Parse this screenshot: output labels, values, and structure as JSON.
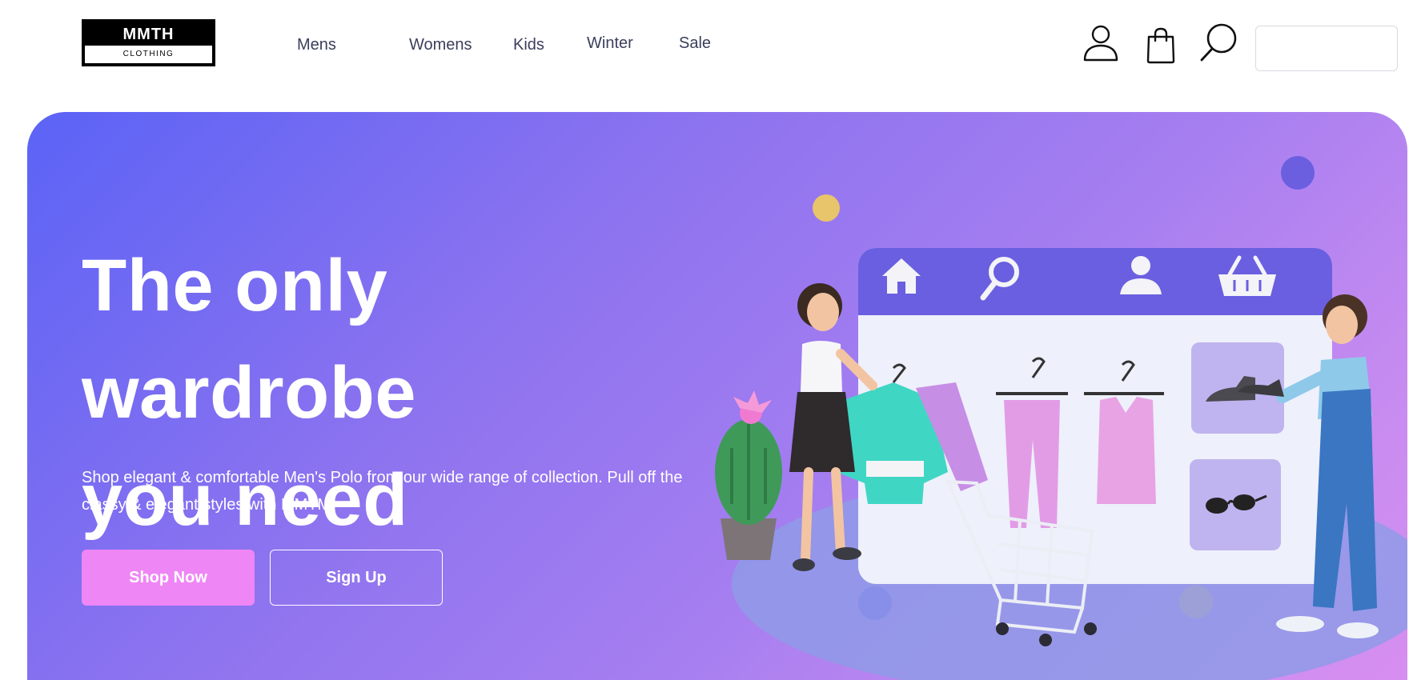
{
  "header": {
    "logo": {
      "brand": "MMTH",
      "sub": "CLOTHING"
    },
    "nav": {
      "mens": "Mens",
      "womens": "Womens",
      "kids": "Kids",
      "winter": "Winter",
      "sale": "Sale"
    },
    "icons": [
      "user-icon",
      "shopping-bag-icon",
      "search-icon"
    ],
    "search": {
      "value": "",
      "placeholder": ""
    }
  },
  "hero": {
    "title_line1": "The only wardrobe",
    "title_line2": "you need",
    "description": "Shop elegant & comfortable Men's Polo from our wide range of collection. Pull off the classy & elegant styles with MMTM.",
    "buttons": {
      "shop_now": "Shop Now",
      "sign_up": "Sign Up"
    },
    "gradient": {
      "start": "#5b63f6",
      "middle": "#a57ef0",
      "end": "#d88ff0"
    },
    "shop_button_color": "#ef86f5"
  }
}
